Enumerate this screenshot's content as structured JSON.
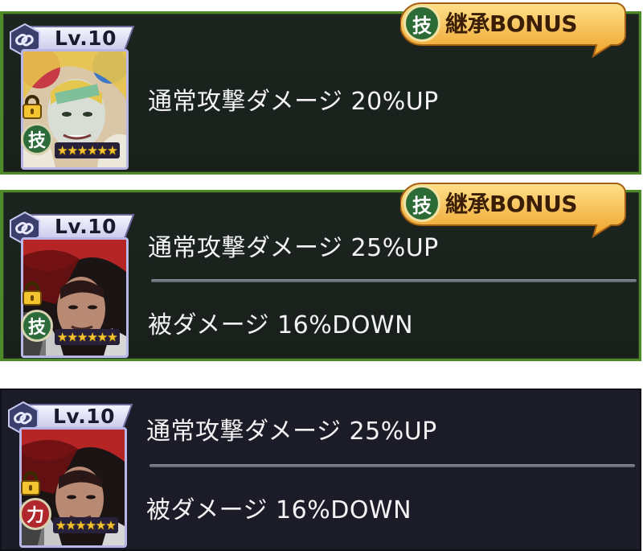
{
  "cards": [
    {
      "level": "Lv.10",
      "type_badge": "技",
      "type": "skill",
      "stars": "★★★★★★",
      "effects": [
        "通常攻撃ダメージ 20%UP"
      ],
      "bonus_label": "継承BONUS",
      "bonus_icon": "技"
    },
    {
      "level": "Lv.10",
      "type_badge": "技",
      "type": "skill",
      "stars": "★★★★★★",
      "effects": [
        "通常攻撃ダメージ 25%UP",
        "被ダメージ 16%DOWN"
      ],
      "bonus_label": "継承BONUS",
      "bonus_icon": "技"
    },
    {
      "level": "Lv.10",
      "type_badge": "力",
      "type": "power",
      "stars": "★★★★★★",
      "effects": [
        "通常攻撃ダメージ 25%UP",
        "被ダメージ 16%DOWN"
      ]
    }
  ],
  "colors": {
    "card_green_border": "#4f8a2a",
    "card_dark_bg": "#1b1c27",
    "bonus_gold": "#f2b53a",
    "skill_green": "#2d6b3a",
    "power_red": "#b0272c"
  }
}
